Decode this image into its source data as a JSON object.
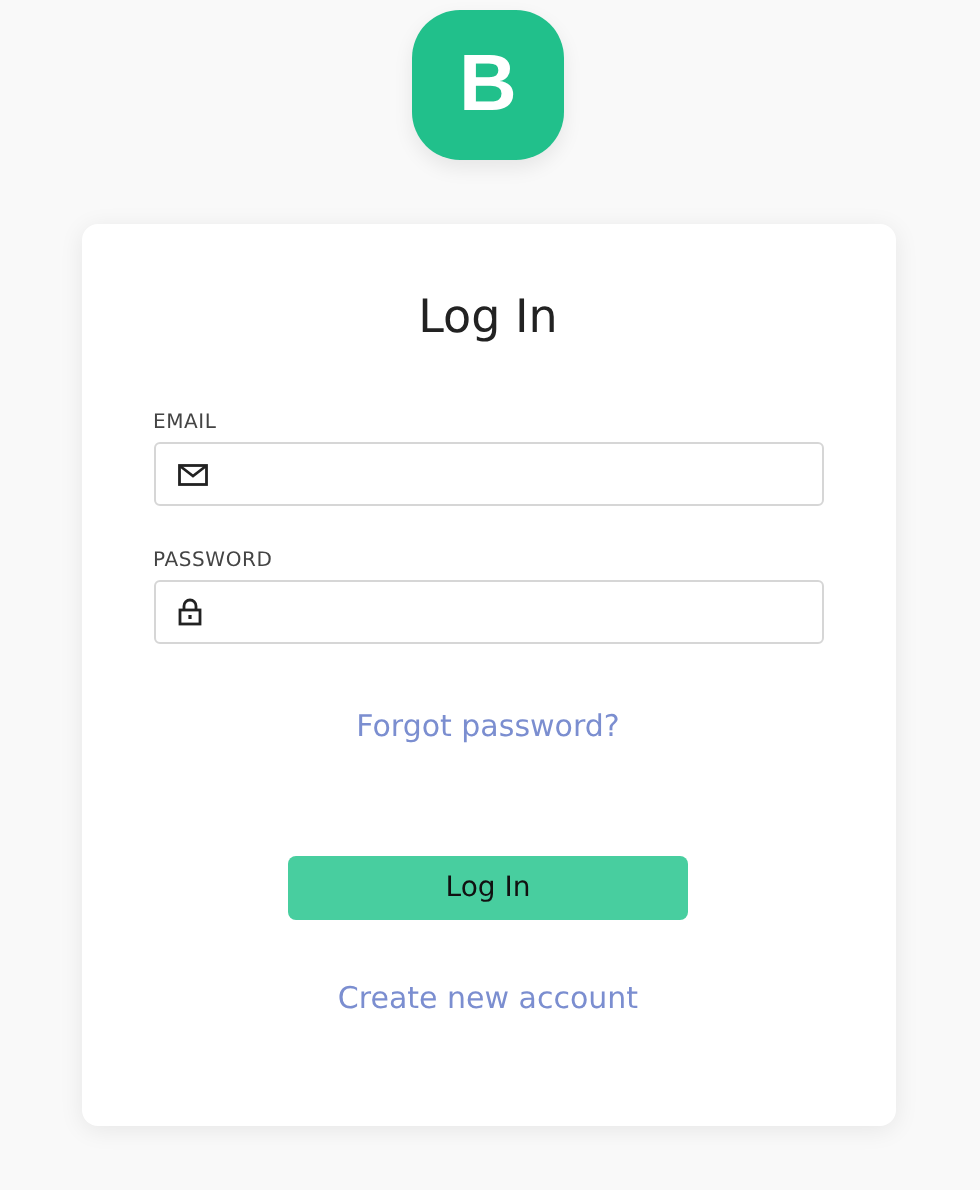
{
  "logo": {
    "letter": "B"
  },
  "title": "Log In",
  "fields": [
    {
      "kind": "email",
      "label": "EMAIL"
    },
    {
      "kind": "password",
      "label": "PASSWORD"
    }
  ],
  "forgot_link": "Forgot password?",
  "submit_button": "Log In",
  "create_link": "Create new account"
}
